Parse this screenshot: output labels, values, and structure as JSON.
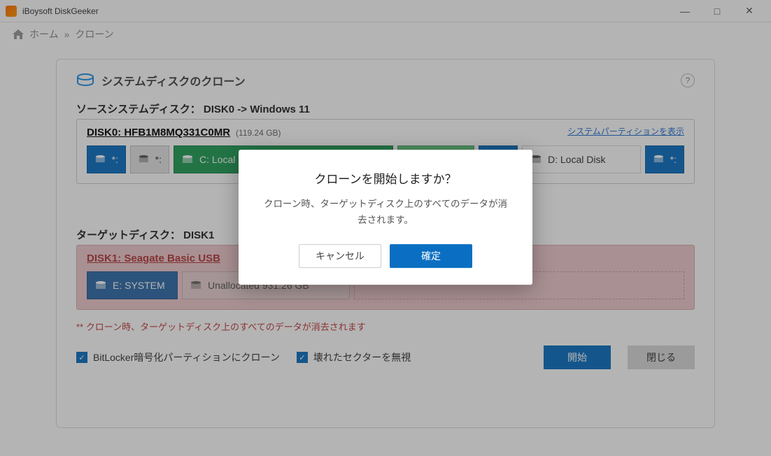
{
  "app": {
    "title": "iBoysoft DiskGeeker"
  },
  "breadcrumb": {
    "home": "ホーム",
    "sep": "»",
    "current": "クローン"
  },
  "card": {
    "title": "システムディスクのクローン",
    "help": "?"
  },
  "source": {
    "heading": "ソースシステムディスク： DISK0 -> Windows 11",
    "disk_label": "DISK0: HFB1M8MQ331C0MR",
    "disk_size": "(119.24 GB)",
    "show_system": "システムパーティションを表示",
    "parts": {
      "p0": "*:",
      "p1": "*:",
      "p2": "C: Local Disk",
      "p3": "*:",
      "p4": "D: Local Disk",
      "p5": "*:"
    }
  },
  "target": {
    "heading": "ターゲットディスク： DISK1",
    "disk_label": "DISK1: Seagate Basic USB",
    "parts": {
      "p0": "E: SYSTEM",
      "p1": "Unallocated 931.26 GB"
    }
  },
  "warning": "** クローン時、ターゲットディスク上のすべてのデータが消去されます",
  "options": {
    "bitlocker": "BitLocker暗号化パーティションにクローン",
    "badsector": "壊れたセクターを無視"
  },
  "actions": {
    "start": "開始",
    "close": "閉じる"
  },
  "modal": {
    "title": "クローンを開始しますか？",
    "body": "クローン時、ターゲットディスク上のすべてのデータが消去されます。",
    "cancel": "キャンセル",
    "ok": "確定"
  }
}
